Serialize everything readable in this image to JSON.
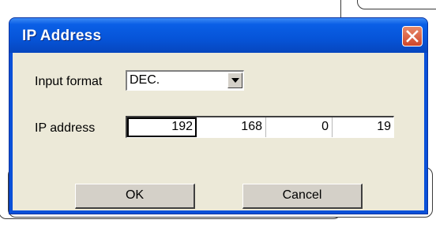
{
  "dialog": {
    "title": "IP Address",
    "close_icon": "close-icon"
  },
  "form": {
    "input_format_label": "Input format",
    "input_format_value": "DEC.",
    "ip_address_label": "IP address",
    "octets": [
      "192",
      "168",
      "0",
      "19"
    ]
  },
  "buttons": {
    "ok_label": "OK",
    "cancel_label": "Cancel"
  },
  "colors": {
    "titlebar": "#0a5fe6",
    "client_background": "#ece9d8",
    "close_button": "#d0462a"
  }
}
